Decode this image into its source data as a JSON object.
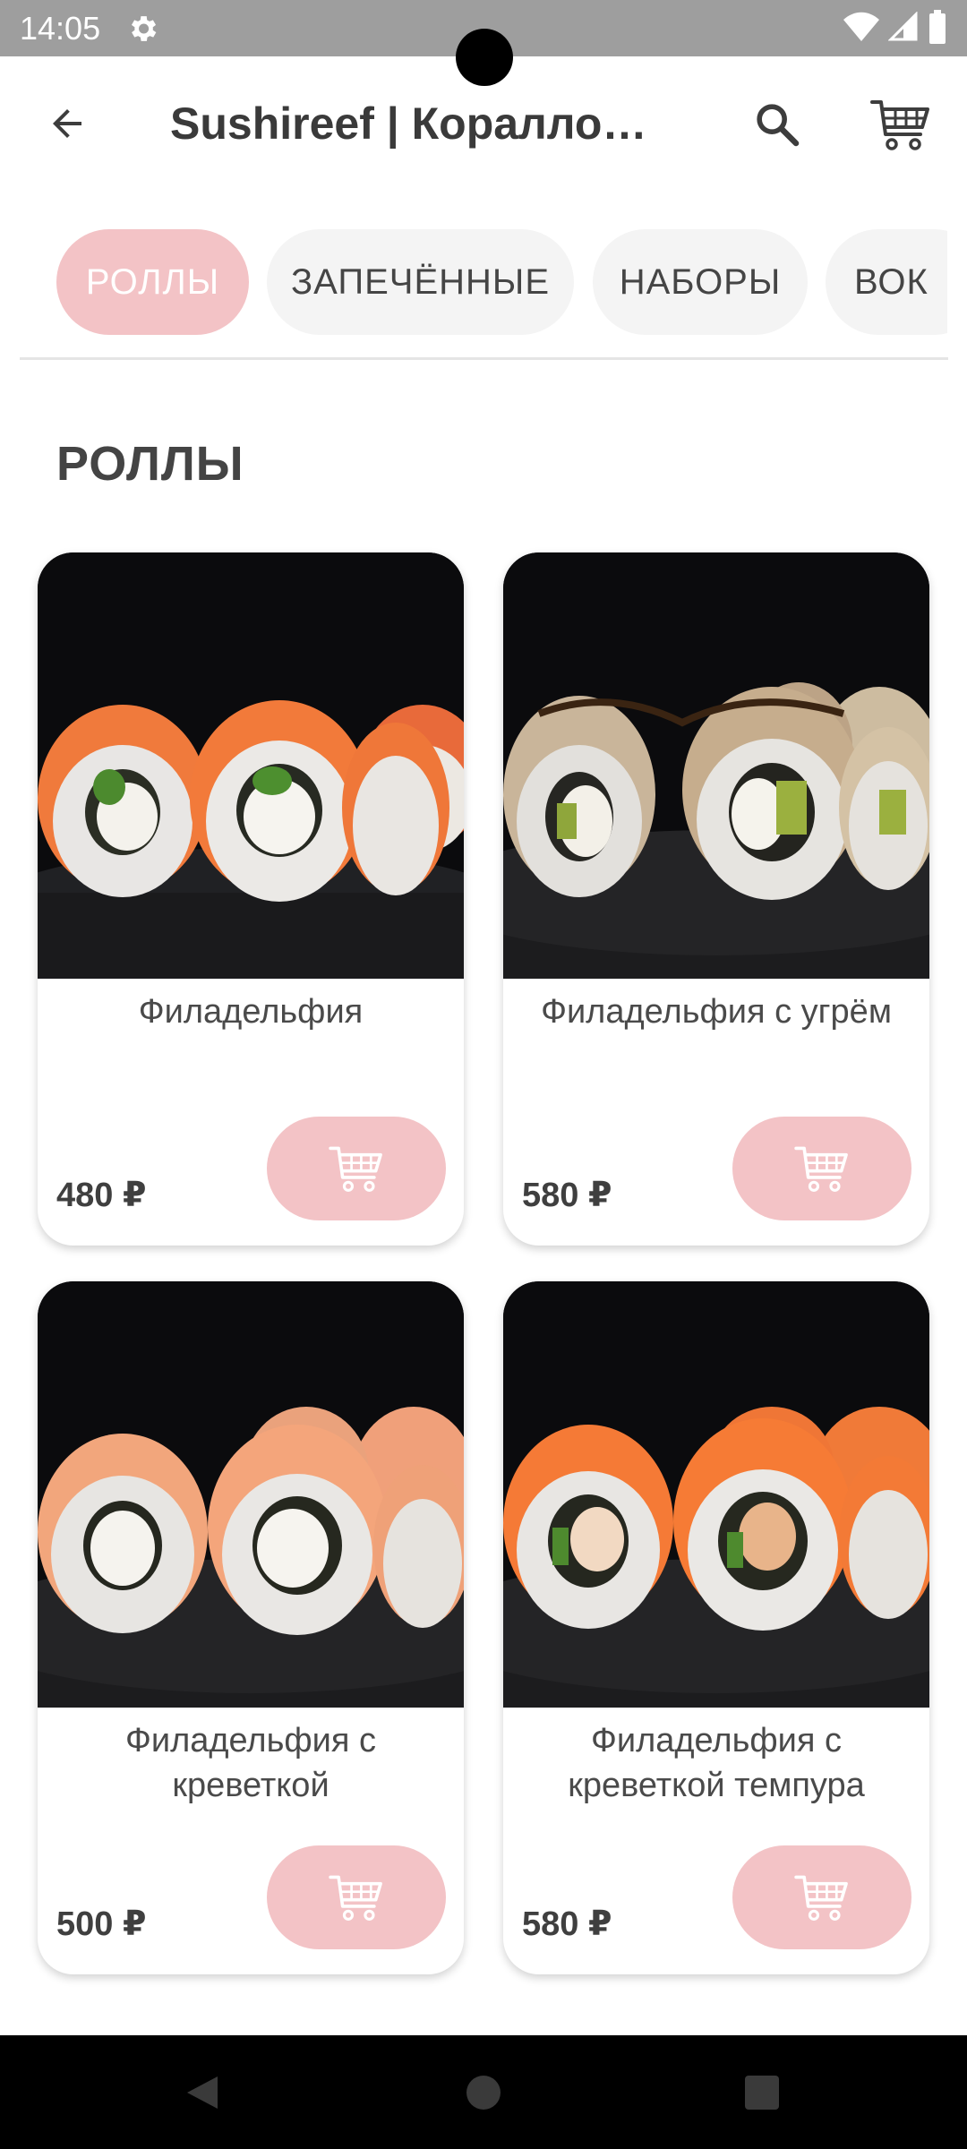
{
  "status_bar": {
    "time": "14:05",
    "icons": [
      "gear-icon",
      "wifi-icon",
      "signal-icon",
      "battery-icon"
    ]
  },
  "app_bar": {
    "title": "Sushireef | Кораллово",
    "back_icon": "arrow-left-icon",
    "search_icon": "search-icon",
    "cart_icon": "cart-icon"
  },
  "tabs": [
    {
      "label": "РОЛЛЫ",
      "active": true
    },
    {
      "label": "ЗАПЕЧЁННЫЕ",
      "active": false
    },
    {
      "label": "НАБОРЫ",
      "active": false
    },
    {
      "label": "ВОК",
      "active": false
    }
  ],
  "section": {
    "title": "РОЛЛЫ"
  },
  "products": [
    {
      "name": "Филадельфия",
      "price": "480 ₽"
    },
    {
      "name": "Филадельфия с угрём",
      "price": "580 ₽"
    },
    {
      "name": "Филадельфия с креветкой",
      "price": "500 ₽"
    },
    {
      "name": "Филадельфия с креветкой темпура",
      "price": "580 ₽"
    }
  ],
  "colors": {
    "accent": "#f3c3c6",
    "status_bar": "#9e9e9e",
    "tab_inactive": "#f4f4f4",
    "nav_bar": "#000000"
  },
  "nav_bar": {
    "icons": [
      "nav-back-icon",
      "nav-home-icon",
      "nav-recents-icon"
    ]
  }
}
